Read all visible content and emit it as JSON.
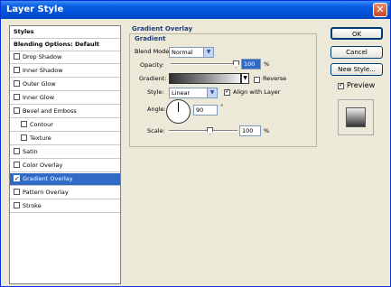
{
  "window": {
    "title": "Layer Style",
    "close_glyph": "✕"
  },
  "sidebar": {
    "header": "Styles",
    "blending": "Blending Options: Default",
    "items": [
      {
        "label": "Drop Shadow",
        "checked": false
      },
      {
        "label": "Inner Shadow",
        "checked": false
      },
      {
        "label": "Outer Glow",
        "checked": false
      },
      {
        "label": "Inner Glow",
        "checked": false
      },
      {
        "label": "Bevel and Emboss",
        "checked": false
      },
      {
        "label": "Contour",
        "checked": false
      },
      {
        "label": "Texture",
        "checked": false
      },
      {
        "label": "Satin",
        "checked": false
      },
      {
        "label": "Color Overlay",
        "checked": false
      },
      {
        "label": "Gradient Overlay",
        "checked": true
      },
      {
        "label": "Pattern Overlay",
        "checked": false
      },
      {
        "label": "Stroke",
        "checked": false
      }
    ]
  },
  "panel": {
    "title": "Gradient Overlay",
    "group_title": "Gradient",
    "blend_mode_label": "Blend Mode:",
    "blend_mode_value": "Normal",
    "opacity_label": "Opacity:",
    "opacity_value": "100",
    "opacity_unit": "%",
    "gradient_label": "Gradient:",
    "reverse_label": "Reverse",
    "style_label": "Style:",
    "style_value": "Linear",
    "align_label": "Align with Layer",
    "angle_label": "Angle:",
    "angle_value": "90",
    "angle_unit": "°",
    "scale_label": "Scale:",
    "scale_value": "100",
    "scale_unit": "%"
  },
  "buttons": {
    "ok": "OK",
    "cancel": "Cancel",
    "new_style": "New Style...",
    "preview": "Preview"
  }
}
